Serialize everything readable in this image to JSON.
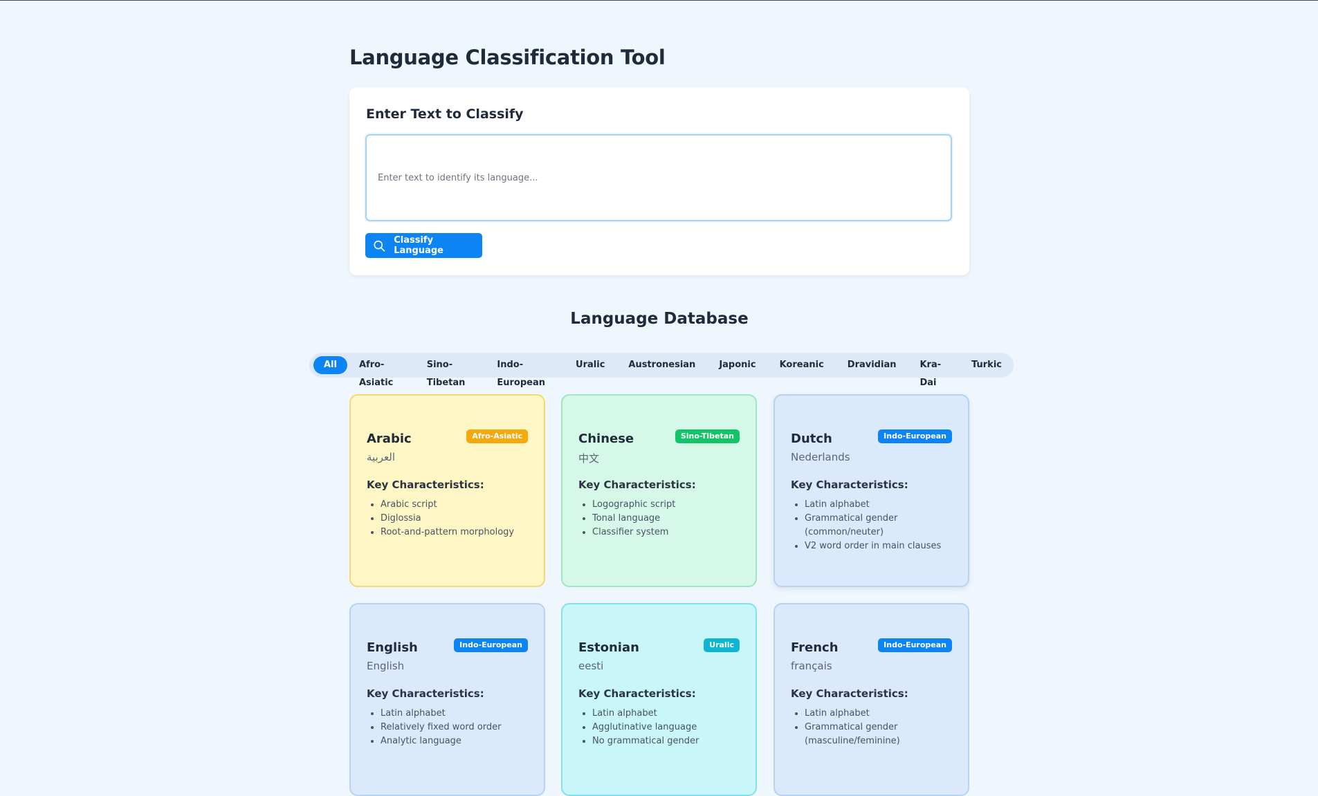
{
  "page": {
    "title": "Language Classification Tool"
  },
  "input": {
    "heading": "Enter Text to Classify",
    "placeholder": "Enter text to identify its language...",
    "button_label": "Classify Language"
  },
  "database": {
    "title": "Language Database",
    "filters": [
      "All",
      "Afro-Asiatic",
      "Sino-Tibetan",
      "Indo-European",
      "Uralic",
      "Austronesian",
      "Japonic",
      "Koreanic",
      "Dravidian",
      "Kra-Dai",
      "Turkic"
    ],
    "active_filter": "All",
    "characteristics_heading": "Key Characteristics:",
    "languages": [
      {
        "name": "Arabic",
        "native": "العربية",
        "family": "Afro-Asiatic",
        "family_color": "#f5a90f",
        "traits": [
          "Arabic script",
          "Diglossia",
          "Root-and-pattern morphology"
        ]
      },
      {
        "name": "Chinese",
        "native": "中文",
        "family": "Sino-Tibetan",
        "family_color": "#12c467",
        "traits": [
          "Logographic script",
          "Tonal language",
          "Classifier system"
        ]
      },
      {
        "name": "Dutch",
        "native": "Nederlands",
        "family": "Indo-European",
        "family_color": "#0d84f4",
        "traits": [
          "Latin alphabet",
          "Grammatical gender (common/neuter)",
          "V2 word order in main clauses"
        ]
      },
      {
        "name": "English",
        "native": "English",
        "family": "Indo-European",
        "family_color": "#0d84f4",
        "traits": [
          "Latin alphabet",
          "Relatively fixed word order",
          "Analytic language"
        ]
      },
      {
        "name": "Estonian",
        "native": "eesti",
        "family": "Uralic",
        "family_color": "#0fb6d3",
        "traits": [
          "Latin alphabet",
          "Agglutinative language",
          "No grammatical gender"
        ]
      },
      {
        "name": "French",
        "native": "français",
        "family": "Indo-European",
        "family_color": "#0d84f4",
        "traits": [
          "Latin alphabet",
          "Grammatical gender (masculine/feminine)"
        ]
      }
    ]
  },
  "icons": {
    "classify_button_icon": "search-icon"
  }
}
